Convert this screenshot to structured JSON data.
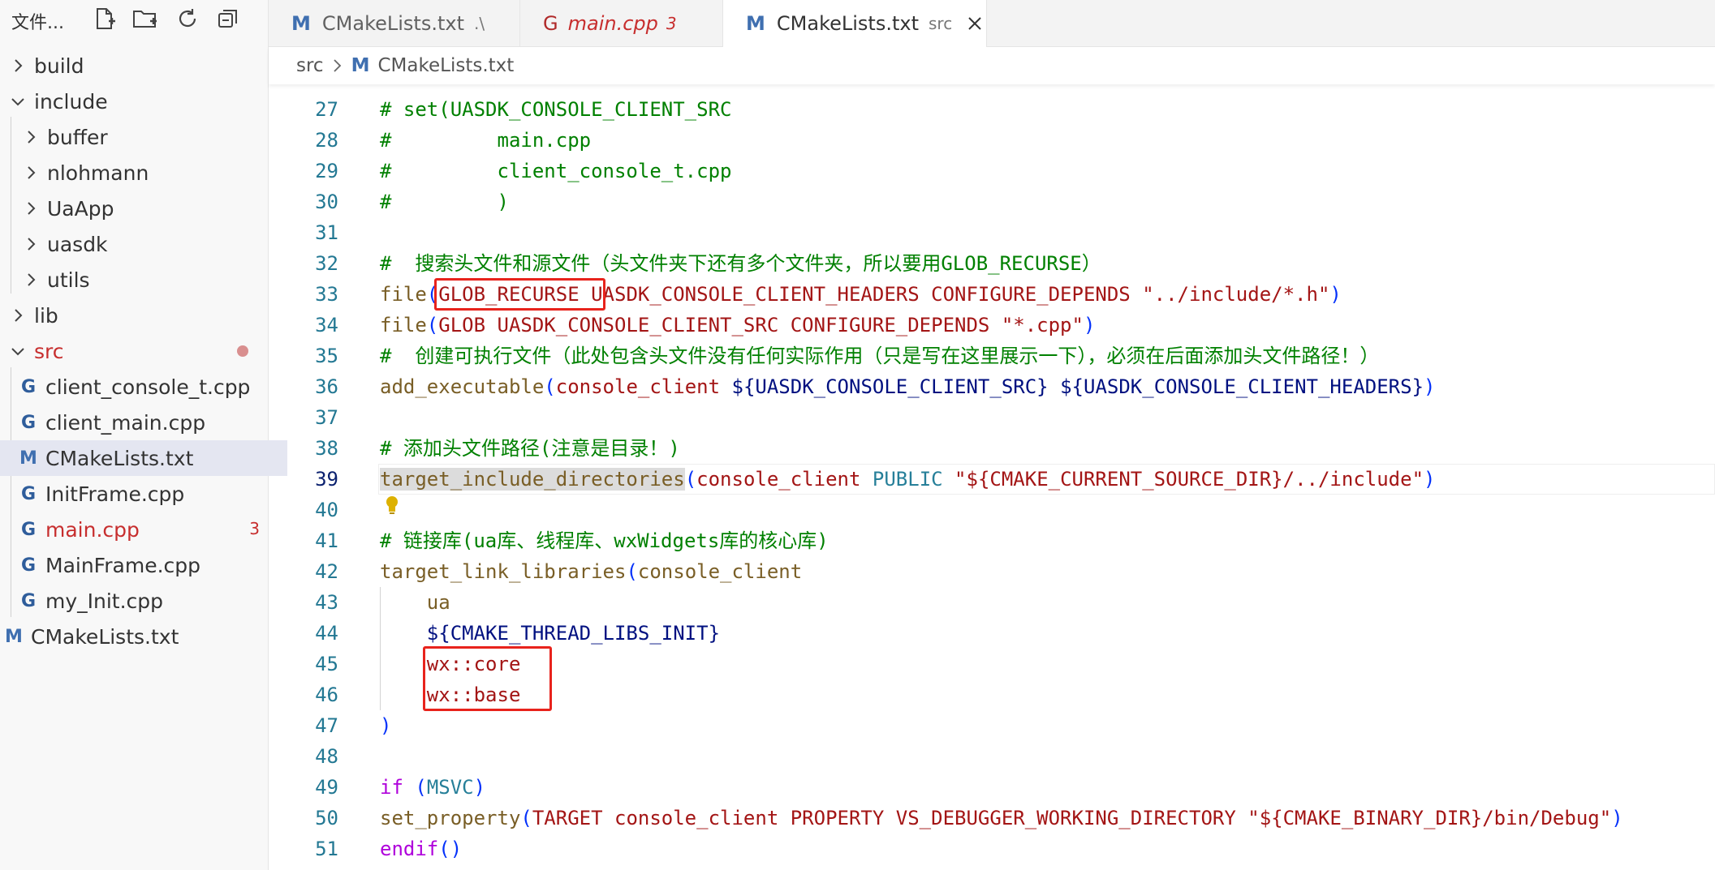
{
  "sidebar": {
    "title": "文件...",
    "items": [
      {
        "label": "build"
      },
      {
        "label": "include"
      },
      {
        "label": "buffer"
      },
      {
        "label": "nlohmann"
      },
      {
        "label": "UaApp"
      },
      {
        "label": "uasdk"
      },
      {
        "label": "utils"
      },
      {
        "label": "lib"
      },
      {
        "label": "src"
      },
      {
        "label": "client_console_t.cpp"
      },
      {
        "label": "client_main.cpp"
      },
      {
        "label": "CMakeLists.txt"
      },
      {
        "label": "InitFrame.cpp"
      },
      {
        "label": "main.cpp",
        "badge": "3"
      },
      {
        "label": "MainFrame.cpp"
      },
      {
        "label": "my_Init.cpp"
      },
      {
        "label": "CMakeLists.txt"
      }
    ]
  },
  "tabs": [
    {
      "name": "CMakeLists.txt",
      "desc": ".\\"
    },
    {
      "name": "main.cpp",
      "desc": "3"
    },
    {
      "name": "CMakeLists.txt",
      "desc": "src"
    }
  ],
  "breadcrumb": {
    "folder": "src",
    "file": "CMakeLists.txt"
  },
  "editor": {
    "lines": [
      {
        "n": "27",
        "t": "# set(UASDK_CONSOLE_CLIENT_SRC"
      },
      {
        "n": "28",
        "t": "#         main.cpp"
      },
      {
        "n": "29",
        "t": "#         client_console_t.cpp"
      },
      {
        "n": "30",
        "t": "#         )"
      },
      {
        "n": "31",
        "t": ""
      },
      {
        "n": "32",
        "t": "#  搜索头文件和源文件（头文件夹下还有多个文件夹，所以要用GLOB_RECURSE）"
      },
      {
        "n": "33",
        "a": "file",
        "b": "(",
        "c": "GLOB_RECURSE UASDK_CONSOLE_CLIENT_HEADERS CONFIGURE_DEPENDS ",
        "d": "\"../include/*.h\"",
        "e": ")"
      },
      {
        "n": "34",
        "a": "file",
        "b": "(",
        "c": "GLOB UASDK_CONSOLE_CLIENT_SRC CONFIGURE_DEPENDS ",
        "d": "\"*.cpp\"",
        "e": ")"
      },
      {
        "n": "35",
        "t": "#  创建可执行文件（此处包含头文件没有任何实际作用（只是写在这里展示一下），必须在后面添加头文件路径！）"
      },
      {
        "n": "36",
        "a": "add_executable",
        "b": "(",
        "c": "console_client ",
        "v1": "${UASDK_CONSOLE_CLIENT_SRC}",
        "sp": " ",
        "v2": "${UASDK_CONSOLE_CLIENT_HEADERS}",
        "e": ")"
      },
      {
        "n": "37",
        "t": ""
      },
      {
        "n": "38",
        "t": "# 添加头文件路径(注意是目录！)"
      },
      {
        "n": "39",
        "a": "target_include_directories",
        "b": "(",
        "c": "console_client ",
        "p": "PUBLIC",
        "d": " \"${CMAKE_CURRENT_SOURCE_DIR}/../include\"",
        "e": ")"
      },
      {
        "n": "40",
        "t": ""
      },
      {
        "n": "41",
        "t": "# 链接库(ua库、线程库、wxWidgets库的核心库)"
      },
      {
        "n": "42",
        "a": "target_link_libraries",
        "b": "(",
        "c": "console_client"
      },
      {
        "n": "43",
        "t": "    ua"
      },
      {
        "n": "44",
        "t": "    ${CMAKE_THREAD_LIBS_INIT}"
      },
      {
        "n": "45",
        "t": "    wx::core"
      },
      {
        "n": "46",
        "t": "    wx::base"
      },
      {
        "n": "47",
        "t": ")"
      },
      {
        "n": "48",
        "t": ""
      },
      {
        "n": "49",
        "a": "if",
        "b": " (",
        "c": "MSVC",
        "e": ")"
      },
      {
        "n": "50",
        "a": "set_property",
        "b": "(",
        "c": "TARGET console_client PROPERTY VS_DEBUGGER_WORKING_DIRECTORY ",
        "d": "\"${CMAKE_BINARY_DIR}/bin/Debug\"",
        "e": ")"
      },
      {
        "n": "51",
        "a": "endif",
        "b": "()"
      }
    ]
  },
  "colors": {
    "annotation": "#e8231c",
    "accent": "#3f6fb0"
  }
}
